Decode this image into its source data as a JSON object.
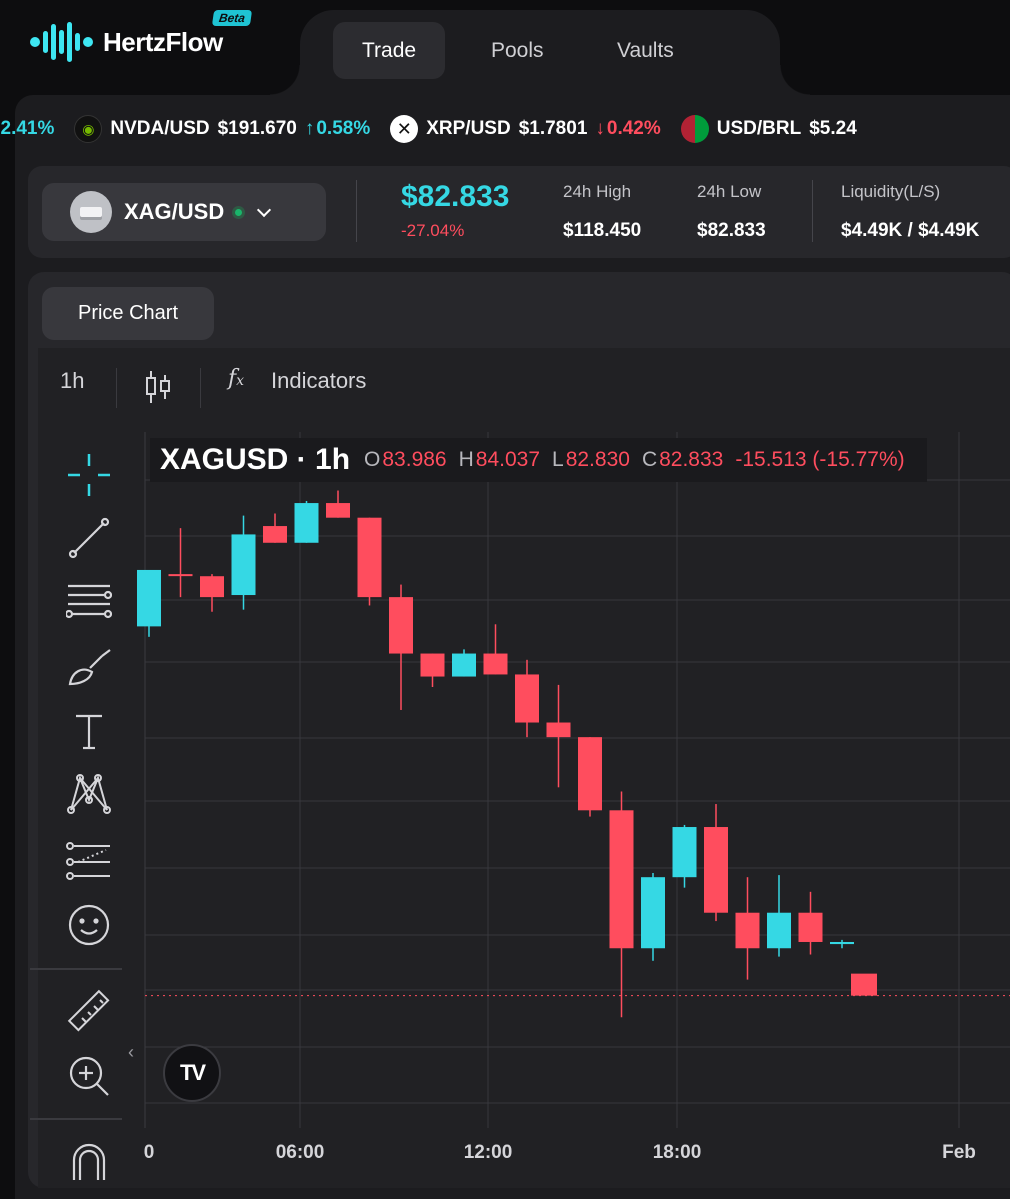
{
  "app": {
    "name": "HertzFlow",
    "badge": "Beta"
  },
  "nav": {
    "tabs": [
      {
        "label": "Trade",
        "active": true
      },
      {
        "label": "Pools",
        "active": false
      },
      {
        "label": "Vaults",
        "active": false
      }
    ]
  },
  "ticker": {
    "lead": {
      "change": "2.41%",
      "direction": "up"
    },
    "items": [
      {
        "symbol": "NVDA/USD",
        "price": "$191.670",
        "change": "0.58%",
        "direction": "up",
        "icon": "nvidia-icon"
      },
      {
        "symbol": "XRP/USD",
        "price": "$1.7801",
        "change": "0.42%",
        "direction": "down",
        "icon": "xrp-icon"
      },
      {
        "symbol": "USD/BRL",
        "price": "$5.24",
        "change": "",
        "direction": "",
        "icon": "usd-brl-flag-icon"
      }
    ]
  },
  "market": {
    "pair": "XAG/USD",
    "last_price": "$82.833",
    "change": "-27.04%",
    "stats": [
      {
        "label": "24h High",
        "value": "$118.450"
      },
      {
        "label": "24h Low",
        "value": "$82.833"
      },
      {
        "label": "Liquidity(L/S)",
        "value": "$4.49K / $4.49K"
      }
    ]
  },
  "chart_panel": {
    "tab": "Price Chart",
    "interval": "1h",
    "indicators_label": "Indicators",
    "legend": {
      "title": "XAGUSD · 1h",
      "o_label": "O",
      "o": "83.986",
      "h_label": "H",
      "h": "84.037",
      "l_label": "L",
      "l": "82.830",
      "c_label": "C",
      "c": "82.833",
      "change": "-15.513 (-15.77%)"
    },
    "tradingview_badge": "TV"
  },
  "colors": {
    "up": "#35d8e4",
    "down": "#ff4d5e",
    "grid": "#38383d"
  },
  "chart_data": {
    "type": "candlestick",
    "x_ticks": [
      "0",
      "06:00",
      "12:00",
      "18:00",
      "Feb"
    ],
    "candles": [
      {
        "o": 100.5,
        "h": 103.0,
        "l": 100.0,
        "c": 103.2,
        "dir": "up"
      },
      {
        "o": 103.0,
        "h": 105.2,
        "l": 101.9,
        "c": 103.0,
        "dir": "down"
      },
      {
        "o": 102.9,
        "h": 103.0,
        "l": 101.2,
        "c": 101.9,
        "dir": "down"
      },
      {
        "o": 102.0,
        "h": 105.8,
        "l": 101.3,
        "c": 104.9,
        "dir": "up"
      },
      {
        "o": 105.3,
        "h": 105.9,
        "l": 104.5,
        "c": 104.5,
        "dir": "down"
      },
      {
        "o": 104.5,
        "h": 106.5,
        "l": 104.5,
        "c": 106.4,
        "dir": "up"
      },
      {
        "o": 106.4,
        "h": 107.0,
        "l": 105.7,
        "c": 105.7,
        "dir": "down"
      },
      {
        "o": 105.7,
        "h": 105.7,
        "l": 101.5,
        "c": 101.9,
        "dir": "down"
      },
      {
        "o": 101.9,
        "h": 102.5,
        "l": 96.5,
        "c": 99.2,
        "dir": "down"
      },
      {
        "o": 99.2,
        "h": 99.2,
        "l": 97.6,
        "c": 98.1,
        "dir": "down"
      },
      {
        "o": 98.1,
        "h": 99.4,
        "l": 98.1,
        "c": 99.2,
        "dir": "up"
      },
      {
        "o": 99.2,
        "h": 100.6,
        "l": 98.2,
        "c": 98.2,
        "dir": "down"
      },
      {
        "o": 98.2,
        "h": 98.9,
        "l": 95.2,
        "c": 95.9,
        "dir": "down"
      },
      {
        "o": 95.9,
        "h": 97.7,
        "l": 92.8,
        "c": 95.2,
        "dir": "down"
      },
      {
        "o": 95.2,
        "h": 95.2,
        "l": 91.4,
        "c": 91.7,
        "dir": "down"
      },
      {
        "o": 91.7,
        "h": 92.6,
        "l": 81.8,
        "c": 85.1,
        "dir": "down"
      },
      {
        "o": 85.1,
        "h": 88.7,
        "l": 84.5,
        "c": 88.5,
        "dir": "up"
      },
      {
        "o": 88.5,
        "h": 91.0,
        "l": 88.0,
        "c": 90.9,
        "dir": "up"
      },
      {
        "o": 90.9,
        "h": 92.0,
        "l": 86.4,
        "c": 86.8,
        "dir": "down"
      },
      {
        "o": 86.8,
        "h": 88.5,
        "l": 83.6,
        "c": 85.1,
        "dir": "down"
      },
      {
        "o": 85.1,
        "h": 88.6,
        "l": 84.7,
        "c": 86.8,
        "dir": "up"
      },
      {
        "o": 86.8,
        "h": 87.8,
        "l": 84.8,
        "c": 85.4,
        "dir": "down"
      },
      {
        "o": 85.3,
        "h": 85.5,
        "l": 85.1,
        "c": 85.4,
        "dir": "up"
      }
    ],
    "last_price": 82.833,
    "ylim": [
      76.5,
      109.8
    ],
    "grid": true
  }
}
